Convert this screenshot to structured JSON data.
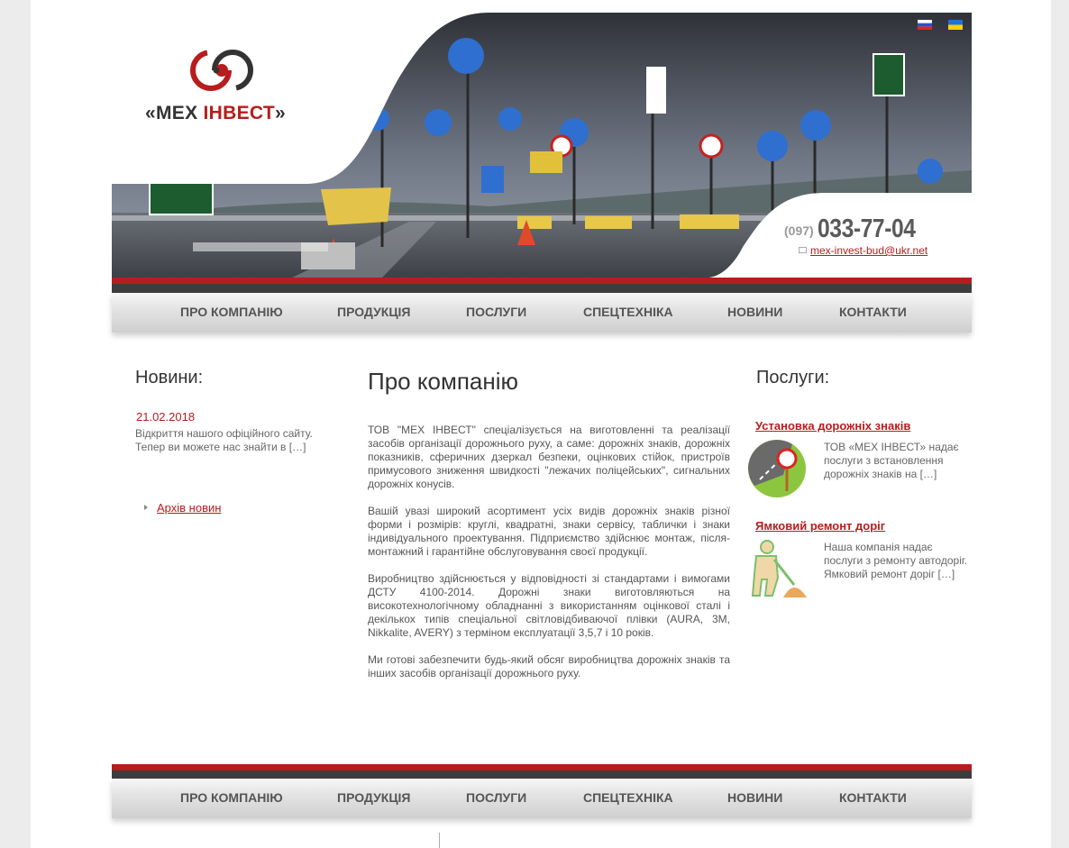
{
  "header": {
    "logo_prefix": "«МЕХ ",
    "logo_accent": "ІНВЕСТ",
    "logo_suffix": "»",
    "phone_code": "(097)",
    "phone_number": "033-77-04",
    "email": "mex-invest-bud@ukr.net",
    "languages": [
      "ru",
      "ua"
    ]
  },
  "nav": {
    "items": [
      "ПРО КОМПАНІЮ",
      "ПРОДУКЦІЯ",
      "ПОСЛУГИ",
      "СПЕЦТЕХНІКА",
      "НОВИНИ",
      "КОНТАКТИ"
    ]
  },
  "news": {
    "title": "Новини:",
    "date": "21.02.2018",
    "text": "Відкриття нашого офіційного сайту. Тепер ви можете нас знайти в […]",
    "archive": "Архів новин"
  },
  "main": {
    "title": "Про компанію",
    "paragraphs": [
      "ТОВ \"МЕХ ІНВЕСТ\" спеціалізується на виготовленні та реалізації засобів організації дорожнього руху, а саме: дорожніх знаків, дорожніх показників, сферичних дзеркал безпеки, оцінкових стійок, пристроїв примусового зниження швидкості \"лежачих поліцейських\", сигнальних дорожніх конусів.",
      "Вашій увазі широкий асортимент усіх видів дорожніх знаків різної форми і розмірів: круглі, квадратні, знаки сервісу, таблички і знаки індивідуального проектування. Підприємство здійснює монтаж, після-монтажний і гарантійне обслуговування своєї продукції.",
      "Виробництво здійснюється у відповідності зі стандартами і вимогами ДСТУ 4100-2014. Дорожні знаки виготовляються на високотехнологічному обладнанні з використанням оцінкової сталі і декількох типів спеціальної світловідбиваючої плівки (AURA, 3M, Nikkalite, AVERY) з терміном експлуатації 3,5,7 і 10 років.",
      "Ми готові забезпечити будь-який обсяг виробництва дорожніх знаків та інших засобів організації дорожнього руху."
    ]
  },
  "services": {
    "title": "Послуги:",
    "items": [
      {
        "title": "Установка дорожніх знаків",
        "text": "ТОВ «МЕХ ІНВЕСТ» надає послуги з встановлення дорожніх знаків на […]",
        "icon": "road-sign-install-icon"
      },
      {
        "title": "Ямковий ремонт доріг",
        "text": "Наша компанія надає послуги з ремонту автодоріг. Ямковий ремонт доріг […]",
        "icon": "road-worker-icon"
      }
    ]
  },
  "colors": {
    "accent": "#b81c1c",
    "dark_bar": "#3d3d3d",
    "text": "#555555"
  }
}
